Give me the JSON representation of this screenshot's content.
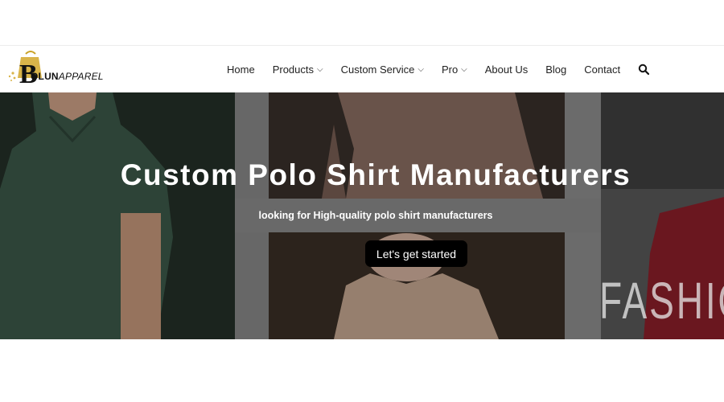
{
  "logo": {
    "brand": "OLUN",
    "initial": "B",
    "suffix": "APPAREL"
  },
  "nav": {
    "items": [
      {
        "label": "Home",
        "dropdown": false
      },
      {
        "label": "Products",
        "dropdown": true
      },
      {
        "label": "Custom Service",
        "dropdown": true
      },
      {
        "label": "Pro",
        "dropdown": true
      },
      {
        "label": "About Us",
        "dropdown": false
      },
      {
        "label": "Blog",
        "dropdown": false
      },
      {
        "label": "Contact",
        "dropdown": false
      }
    ],
    "search_icon": "search-icon",
    "dropdown_icon": "chevron-down-icon"
  },
  "hero": {
    "title": "Custom Polo Shirt Manufacturers",
    "subtitle": "looking for High-quality polo shirt manufacturers",
    "cta_label": "Let's get started",
    "background_text": "FASHIO"
  },
  "colors": {
    "cta_bg": "#000000",
    "logo_gold": "#c9a227",
    "nav_text": "#222222"
  }
}
